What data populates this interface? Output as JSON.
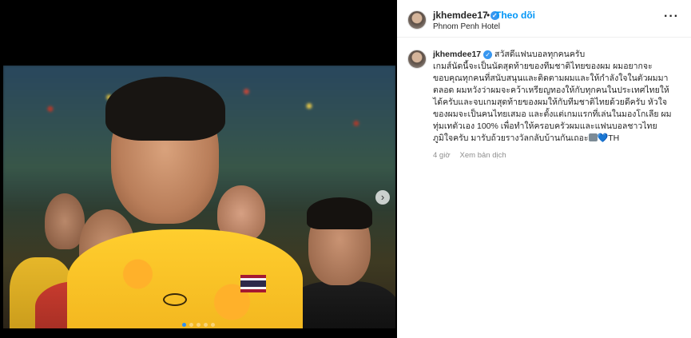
{
  "post": {
    "username": "jkhemdee17",
    "dot": "•",
    "follow_label": "Theo dõi",
    "location": "Phnom Penh Hotel",
    "more_label": "···"
  },
  "caption": {
    "username": "jkhemdee17",
    "greeting": "สวัสดีแฟนบอลทุกคนครับ",
    "body": "เกมส์นัดนี้จะเป็นนัดสุดท้ายของทีมชาติไทยของผม ผมอยากจะขอบคุณทุกคนที่สนับสนุนและติดตามผมและให้กำลังใจในตัวผมมาตลอด ผมหวังว่าผมจะคว้าเหรียญทองให้กับทุกคนในประเทศไทยให้ได้ครับและจบเกมสุดท้ายของผมให้กับทีมชาติไทยด้วยดีครับ หัวใจของผมจะเป็นคนไทยเสมอ และตั้งแต่เกมแรกที่เล่นในมองโกเลีย ผมทุ่มเทตัวเอง 100% เพื่อทำให้ครอบครัวผมและแฟนบอลชาวไทยภูมิใจครับ มารับถ้วยรางวัลกลับบ้านกันเถอะ",
    "heart_emoji": "💙",
    "suffix": "TH",
    "time_ago": "4 giờ",
    "translate_label": "Xem bản dịch"
  },
  "media": {
    "next_label": "›",
    "carousel_count": 5,
    "carousel_active": 1,
    "flag_colors": [
      "#a51931",
      "#f4f5f8",
      "#2d2a4a",
      "#2d2a4a",
      "#f4f5f8",
      "#a51931"
    ]
  },
  "colors": {
    "accent": "#0095f6",
    "verified": "#3897f0",
    "text": "#262626",
    "muted": "#8e8e8e"
  }
}
